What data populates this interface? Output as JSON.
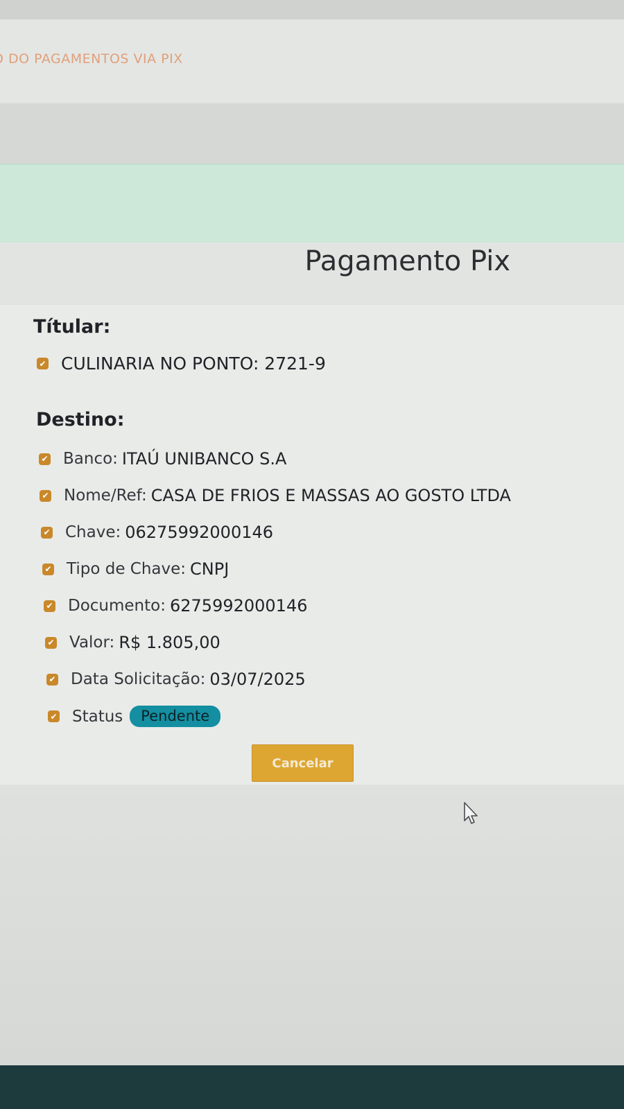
{
  "header": {
    "title": "O DO PAGAMENTOS VIA PIX"
  },
  "modal": {
    "title": "Pagamento Pix",
    "titular_label": "Títular:",
    "titular_value": "CULINARIA NO PONTO: 2721-9",
    "destino_label": "Destino:",
    "fields": [
      {
        "label": "Banco:",
        "value": "ITAÚ UNIBANCO S.A"
      },
      {
        "label": "Nome/Ref:",
        "value": "CASA DE FRIOS E MASSAS AO GOSTO LTDA"
      },
      {
        "label": "Chave:",
        "value": "06275992000146"
      },
      {
        "label": "Tipo de Chave:",
        "value": "CNPJ"
      },
      {
        "label": "Documento:",
        "value": "6275992000146"
      },
      {
        "label": "Valor:",
        "value": "R$ 1.805,00"
      },
      {
        "label": "Data Solicitação:",
        "value": "03/07/2025"
      }
    ],
    "status_label": "Status",
    "status_value": "Pendente",
    "cancel_label": "Cancelar"
  },
  "colors": {
    "accent_button": "#dda633",
    "check_icon": "#c9882a",
    "status_badge": "#138fa1",
    "green_band": "#cde7d8",
    "header_title": "#e0a07a"
  },
  "icons": {
    "field_marker": "checkbox-checked-icon",
    "pointer": "mouse-cursor-icon"
  }
}
